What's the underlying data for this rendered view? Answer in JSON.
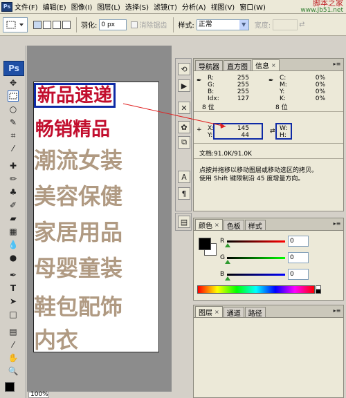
{
  "menubar": {
    "app_icon": "Ps",
    "items": [
      "文件(F)",
      "编辑(E)",
      "图像(I)",
      "图层(L)",
      "选择(S)",
      "滤镜(T)",
      "分析(A)",
      "视图(V)",
      "窗口(W)"
    ],
    "watermark_line1": "脚本之家",
    "watermark_line2": "www.Jb51.net"
  },
  "options_bar": {
    "feather_label": "羽化:",
    "feather_value": "0 px",
    "antialias_label": "消除锯齿",
    "style_label": "样式:",
    "style_value": "正常",
    "width_label": "宽度:"
  },
  "toolbox": {
    "logo": "Ps",
    "tools": [
      "move-tool",
      "marquee-tool",
      "lasso-tool",
      "quick-selection-tool",
      "crop-tool",
      "eyedropper-tool",
      "healing-brush-tool",
      "brush-tool",
      "clone-stamp-tool",
      "history-brush-tool",
      "eraser-tool",
      "gradient-tool",
      "blur-tool",
      "dodge-tool",
      "pen-tool",
      "type-tool",
      "path-selection-tool",
      "shape-tool",
      "notes-tool",
      "eyedropper2-tool",
      "hand-tool",
      "zoom-tool"
    ]
  },
  "document": {
    "lines": [
      "新品速递",
      "畅销精品",
      "潮流女装",
      "美容保健",
      "家居用品",
      "母婴童装",
      "鞋包配饰",
      "内衣"
    ]
  },
  "status": {
    "zoom": "100%"
  },
  "info_panel": {
    "tabs": [
      "导航器",
      "直方图",
      "信息"
    ],
    "active_tab": "信息",
    "rgb": {
      "R": "255",
      "G": "255",
      "B": "255",
      "Idx": "127",
      "bits": "8 位"
    },
    "cmyk": {
      "C": "0%",
      "M": "0%",
      "Y": "0%",
      "K": "0%",
      "bits": "8 位"
    },
    "x_label": "X:",
    "x_value": "145",
    "y_label": "Y:",
    "y_value": "44",
    "w_label": "W:",
    "h_label": "H:",
    "doc_size": "文档:91.0K/91.0K",
    "hint_line1": "点按并拖移以移动图层或移动选区的拷贝。",
    "hint_line2": "使用 Shift 键限制沿 45 度增量方向。"
  },
  "color_panel": {
    "tabs": [
      "颜色",
      "色板",
      "样式"
    ],
    "active_tab": "颜色",
    "r_label": "R",
    "r_value": "0",
    "g_label": "G",
    "g_value": "0",
    "b_label": "B",
    "b_value": "0"
  },
  "layers_panel": {
    "tabs": [
      "图层",
      "通道",
      "路径"
    ],
    "active_tab": "图层"
  },
  "colors": {
    "highlight_box": "#0e2aa6",
    "red_text": "#c20e2e",
    "brown_text": "#b09a82",
    "arrow": "#e02020"
  }
}
